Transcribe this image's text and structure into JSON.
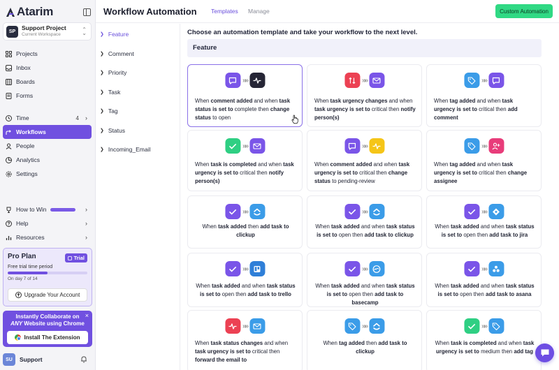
{
  "app": {
    "logo_text": "Atarim"
  },
  "workspace": {
    "initials": "SP",
    "name": "Support Project",
    "subtitle": "Current Workspace"
  },
  "nav": {
    "projects": "Projects",
    "inbox": "Inbox",
    "boards": "Boards",
    "forms": "Forms",
    "time": "Time",
    "time_count": "4",
    "workflows": "Workflows",
    "people": "People",
    "analytics": "Analytics",
    "settings": "Settings",
    "how_to_win": "How to Win",
    "help": "Help",
    "resources": "Resources"
  },
  "pro_plan": {
    "title": "Pro Plan",
    "badge": "Trial",
    "subtitle": "Free trial time period",
    "progress_fraction": 0.5,
    "day_text": "On day 7 of 14",
    "upgrade_label": "Upgrade Your Account"
  },
  "promo": {
    "line1": "Instantly Collaborate on",
    "line2_em": "ANY",
    "line2_rest": " Website using Chrome",
    "button": "Install The Extension",
    "close": "×"
  },
  "support": {
    "initials": "SU",
    "name": "Support"
  },
  "header": {
    "title": "Workflow Automation",
    "tab_templates": "Templates",
    "tab_manage": "Manage",
    "custom_button": "Custom Automation"
  },
  "categories": [
    "Feature",
    "Comment",
    "Priority",
    "Task",
    "Tag",
    "Status",
    "Incoming_Email"
  ],
  "main": {
    "intro": "Choose an automation template and take your workflow to the next level.",
    "section_title": "Feature"
  },
  "cards": [
    {
      "icons": [
        "comment-icon",
        "activity-icon"
      ],
      "colors": [
        "#7a55e8",
        "#262636"
      ],
      "segments": [
        [
          "When ",
          false
        ],
        [
          "comment added",
          true
        ],
        [
          " and when ",
          false
        ],
        [
          "task status is set to",
          true
        ],
        [
          " complete then ",
          false
        ],
        [
          "change status",
          true
        ],
        [
          " to open",
          false
        ]
      ]
    },
    {
      "icons": [
        "urgency-icon",
        "mail-icon"
      ],
      "colors": [
        "#ec4153",
        "#7a55e8"
      ],
      "segments": [
        [
          "When ",
          false
        ],
        [
          "task urgency changes",
          true
        ],
        [
          " and when ",
          false
        ],
        [
          "task urgency is set to",
          true
        ],
        [
          " critical then ",
          false
        ],
        [
          "notify person(s)",
          true
        ]
      ]
    },
    {
      "icons": [
        "tag-icon",
        "comment-icon"
      ],
      "colors": [
        "#3b9ce8",
        "#7a55e8"
      ],
      "segments": [
        [
          "When ",
          false
        ],
        [
          "tag added",
          true
        ],
        [
          " and when ",
          false
        ],
        [
          "task urgency is set to",
          true
        ],
        [
          " critical then ",
          false
        ],
        [
          "add comment",
          true
        ]
      ]
    },
    {
      "icons": [
        "check-icon",
        "mail-icon"
      ],
      "colors": [
        "#2fcf83",
        "#7a55e8"
      ],
      "segments": [
        [
          "When ",
          false
        ],
        [
          "task is completed",
          true
        ],
        [
          " and when ",
          false
        ],
        [
          "task urgency is set to",
          true
        ],
        [
          " critical then ",
          false
        ],
        [
          "notify person(s)",
          true
        ]
      ]
    },
    {
      "icons": [
        "comment-icon",
        "activity-icon"
      ],
      "colors": [
        "#7a55e8",
        "#f5c518"
      ],
      "segments": [
        [
          "When ",
          false
        ],
        [
          "comment added",
          true
        ],
        [
          " and when ",
          false
        ],
        [
          "task urgency is set to",
          true
        ],
        [
          " critical then ",
          false
        ],
        [
          "change status",
          true
        ],
        [
          " to pending-review",
          false
        ]
      ]
    },
    {
      "icons": [
        "tag-icon",
        "add-user-icon"
      ],
      "colors": [
        "#3b9ce8",
        "#e83c7a"
      ],
      "segments": [
        [
          "When ",
          false
        ],
        [
          "tag added",
          true
        ],
        [
          " and when ",
          false
        ],
        [
          "task urgency is set to",
          true
        ],
        [
          " critical then ",
          false
        ],
        [
          "change assignee",
          true
        ]
      ]
    },
    {
      "icons": [
        "check-icon",
        "clickup-icon"
      ],
      "colors": [
        "#7a55e8",
        "#3b9ce8"
      ],
      "segments": [
        [
          "When ",
          false
        ],
        [
          "task added",
          true
        ],
        [
          " then ",
          false
        ],
        [
          "add task to clickup",
          true
        ]
      ]
    },
    {
      "icons": [
        "check-icon",
        "clickup-icon"
      ],
      "colors": [
        "#7a55e8",
        "#3b9ce8"
      ],
      "segments": [
        [
          "When ",
          false
        ],
        [
          "task added",
          true
        ],
        [
          " and when ",
          false
        ],
        [
          "task status is set to",
          true
        ],
        [
          " open then ",
          false
        ],
        [
          "add task to clickup",
          true
        ]
      ]
    },
    {
      "icons": [
        "check-icon",
        "jira-icon"
      ],
      "colors": [
        "#7a55e8",
        "#3b9ce8"
      ],
      "segments": [
        [
          "When ",
          false
        ],
        [
          "task added",
          true
        ],
        [
          " and when ",
          false
        ],
        [
          "task status is set to",
          true
        ],
        [
          " open then ",
          false
        ],
        [
          "add task to jira",
          true
        ]
      ]
    },
    {
      "icons": [
        "check-icon",
        "trello-icon"
      ],
      "colors": [
        "#7a55e8",
        "#2f7fd8"
      ],
      "segments": [
        [
          "When ",
          false
        ],
        [
          "task added",
          true
        ],
        [
          " and when ",
          false
        ],
        [
          "task status is set to",
          true
        ],
        [
          " open then ",
          false
        ],
        [
          "add task to trello",
          true
        ]
      ]
    },
    {
      "icons": [
        "check-icon",
        "basecamp-icon"
      ],
      "colors": [
        "#7a55e8",
        "#3b9ce8"
      ],
      "segments": [
        [
          "When ",
          false
        ],
        [
          "task added",
          true
        ],
        [
          " and when ",
          false
        ],
        [
          "task status is set to",
          true
        ],
        [
          " open then ",
          false
        ],
        [
          "add task to basecamp",
          true
        ]
      ]
    },
    {
      "icons": [
        "check-icon",
        "asana-icon"
      ],
      "colors": [
        "#7a55e8",
        "#3b9ce8"
      ],
      "segments": [
        [
          "When ",
          false
        ],
        [
          "task added",
          true
        ],
        [
          " and when ",
          false
        ],
        [
          "task status is set to",
          true
        ],
        [
          " open then ",
          false
        ],
        [
          "add task to asana",
          true
        ]
      ]
    },
    {
      "icons": [
        "activity-icon",
        "mail-icon"
      ],
      "colors": [
        "#ec4153",
        "#3b9ce8"
      ],
      "segments": [
        [
          "When ",
          false
        ],
        [
          "task status changes",
          true
        ],
        [
          " and when ",
          false
        ],
        [
          "task urgency is set to",
          true
        ],
        [
          " critical then ",
          false
        ],
        [
          "forward the email to",
          true
        ]
      ]
    },
    {
      "icons": [
        "tag-icon",
        "clickup-icon"
      ],
      "colors": [
        "#3b9ce8",
        "#3b9ce8"
      ],
      "segments": [
        [
          "When ",
          false
        ],
        [
          "tag added",
          true
        ],
        [
          " then ",
          false
        ],
        [
          "add task to clickup",
          true
        ]
      ]
    },
    {
      "icons": [
        "check-icon",
        "tag-icon"
      ],
      "colors": [
        "#2fcf83",
        "#3b9ce8"
      ],
      "segments": [
        [
          "When ",
          false
        ],
        [
          "task is completed",
          true
        ],
        [
          " and when ",
          false
        ],
        [
          "task urgency is set to",
          true
        ],
        [
          " medium then ",
          false
        ],
        [
          "add tag",
          true
        ]
      ]
    }
  ]
}
